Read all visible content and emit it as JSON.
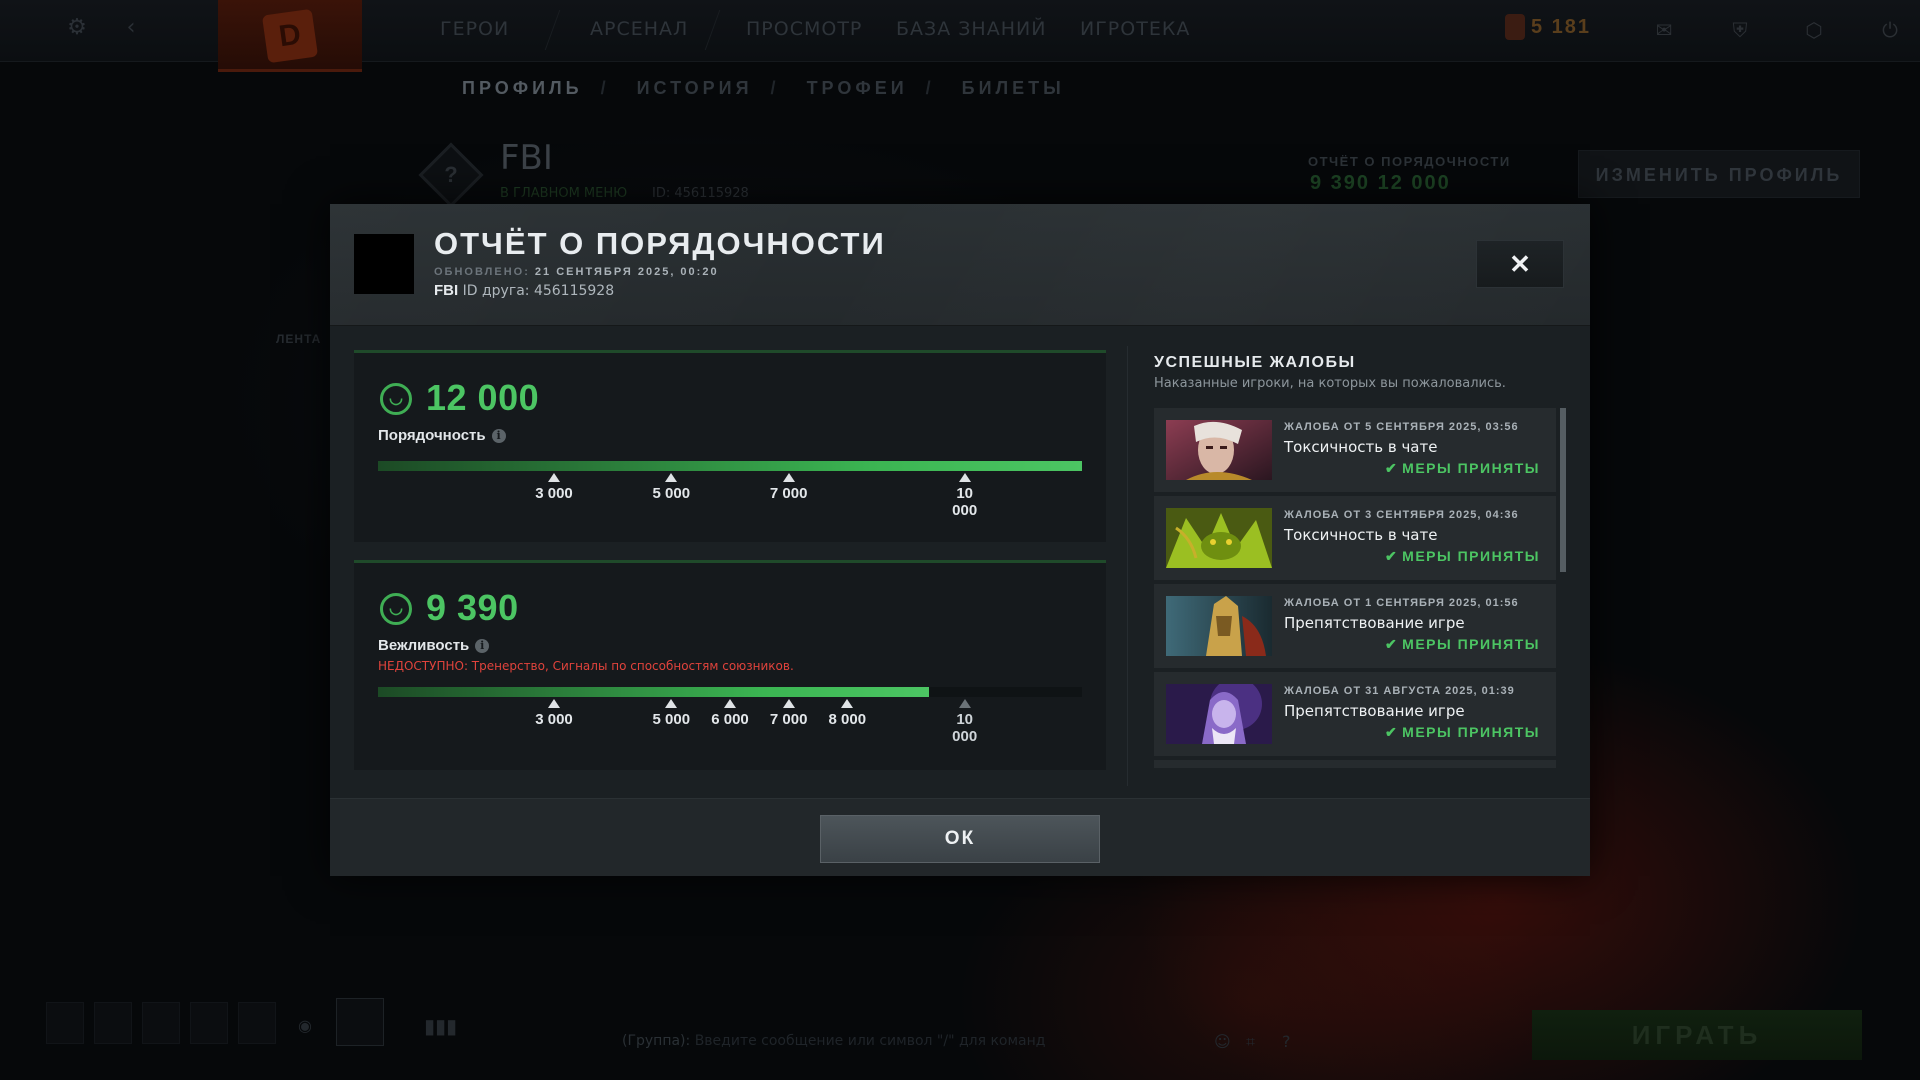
{
  "background": {
    "nav": [
      "ГЕРОИ",
      "АРСЕНАЛ",
      "ПРОСМОТР",
      "БАЗА ЗНАНИЙ",
      "ИГРОТЕКА"
    ],
    "currency": "5 181",
    "sub_nav": [
      "ПРОФИЛЬ",
      "ИСТОРИЯ",
      "ТРОФЕИ",
      "БИЛЕТЫ"
    ],
    "profile_name": "FBI",
    "profile_status": "В ГЛАВНОМ МЕНЮ",
    "profile_id": "ID: 456115928",
    "report_label": "ОТЧЁТ О ПОРЯДОЧНОСТИ",
    "report_values": "9 390  12 000",
    "edit_profile": "ИЗМЕНИТЬ ПРОФИЛЬ",
    "feed_label": "ЛЕНТА",
    "chat_group": "(Группа):",
    "chat_placeholder": "Введите сообщение или символ \"/\" для команд",
    "play": "ИГРАТЬ"
  },
  "modal": {
    "title": "ОТЧЁТ О ПОРЯДОЧНОСТИ",
    "updated_label": "ОБНОВЛЕНО:",
    "updated_value": "21 СЕНТЯБРЯ 2025, 00:20",
    "player_name": "FBI",
    "friend_id_text": "ID друга: 456115928",
    "close_glyph": "✕",
    "ok": "ОК"
  },
  "conduct": {
    "value": "12 000",
    "value_number": 12000,
    "label": "Порядочность",
    "max": 12000,
    "ticks": [
      {
        "text": "3 000",
        "value": 3000,
        "dim": false
      },
      {
        "text": "5 000",
        "value": 5000,
        "dim": false
      },
      {
        "text": "7 000",
        "value": 7000,
        "dim": false
      },
      {
        "text": "10 000",
        "value": 10000,
        "dim": false
      }
    ]
  },
  "behavior": {
    "value": "9 390",
    "value_number": 9390,
    "label": "Вежливость",
    "unavailable": "НЕДОСТУПНО:  Тренерство, Сигналы по способностям союзников.",
    "max": 12000,
    "ticks": [
      {
        "text": "3 000",
        "value": 3000,
        "dim": false
      },
      {
        "text": "5 000",
        "value": 5000,
        "dim": false
      },
      {
        "text": "6 000",
        "value": 6000,
        "dim": false
      },
      {
        "text": "7 000",
        "value": 7000,
        "dim": false
      },
      {
        "text": "8 000",
        "value": 8000,
        "dim": false
      },
      {
        "text": "10 000",
        "value": 10000,
        "dim": true
      }
    ]
  },
  "reports": {
    "title": "УСПЕШНЫЕ ЖАЛОБЫ",
    "subtitle": "Наказанные игроки, на которых вы пожаловались.",
    "items": [
      {
        "date": "ЖАЛОБА ОТ 5 СЕНТЯБРЯ 2025, 03:56",
        "reason": "Токсичность в чате",
        "status": "МЕРЫ ПРИНЯТЫ",
        "hero": "invoker"
      },
      {
        "date": "ЖАЛОБА ОТ 3 СЕНТЯБРЯ 2025, 04:36",
        "reason": "Токсичность в чате",
        "status": "МЕРЫ ПРИНЯТЫ",
        "hero": "venomancer"
      },
      {
        "date": "ЖАЛОБА ОТ 1 СЕНТЯБРЯ 2025, 01:56",
        "reason": "Препятствование игре",
        "status": "МЕРЫ ПРИНЯТЫ",
        "hero": "dragon-knight"
      },
      {
        "date": "ЖАЛОБА ОТ 31 АВГУСТА 2025, 01:39",
        "reason": "Препятствование игре",
        "status": "МЕРЫ ПРИНЯТЫ",
        "hero": "faceless-void"
      }
    ]
  },
  "colors": {
    "accent_green": "#4cc563",
    "warning_red": "#e0433c",
    "modal_bg": "#1d2225"
  }
}
